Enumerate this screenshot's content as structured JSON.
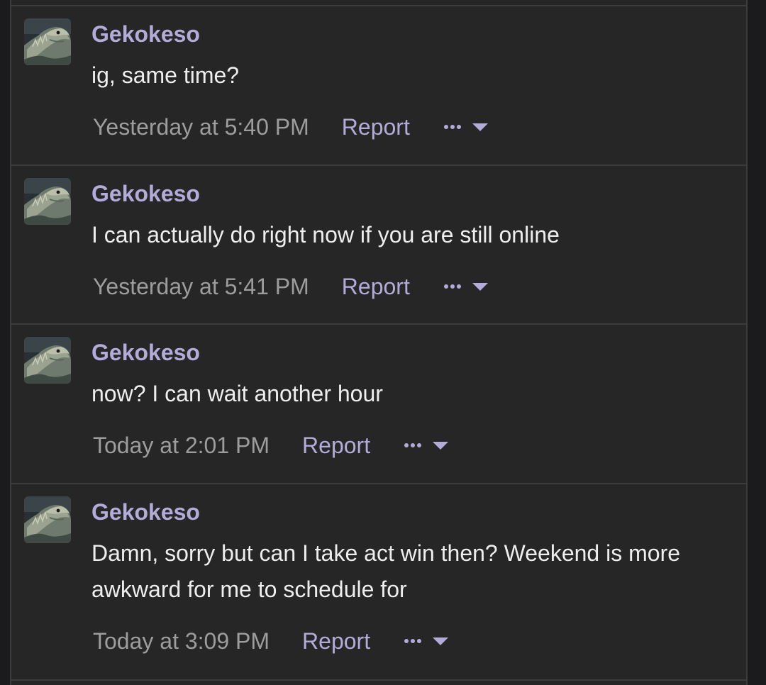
{
  "messages": [
    {
      "username": "Gekokeso",
      "text": "ig, same time?",
      "timestamp": "Yesterday at 5:40 PM",
      "report_label": "Report"
    },
    {
      "username": "Gekokeso",
      "text": "I can actually do right now if you are still online",
      "timestamp": "Yesterday at 5:41 PM",
      "report_label": "Report"
    },
    {
      "username": "Gekokeso",
      "text": "now? I can wait another hour",
      "timestamp": "Today at 2:01 PM",
      "report_label": "Report"
    },
    {
      "username": "Gekokeso",
      "text": "Damn, sorry but can I take act win then? Weekend is more awkward for me to schedule for",
      "timestamp": "Today at 3:09 PM",
      "report_label": "Report"
    }
  ],
  "icons": {
    "avatar": "iguana-avatar",
    "more": "ellipsis-icon",
    "dropdown": "caret-down-icon"
  },
  "colors": {
    "page_background": "#1b1b1d",
    "thread_background": "#262626",
    "divider": "#3c3c3c",
    "username": "#b4acd8",
    "message_text": "#eeeeee",
    "timestamp": "#9d9d9d",
    "link": "#b4acd8"
  }
}
